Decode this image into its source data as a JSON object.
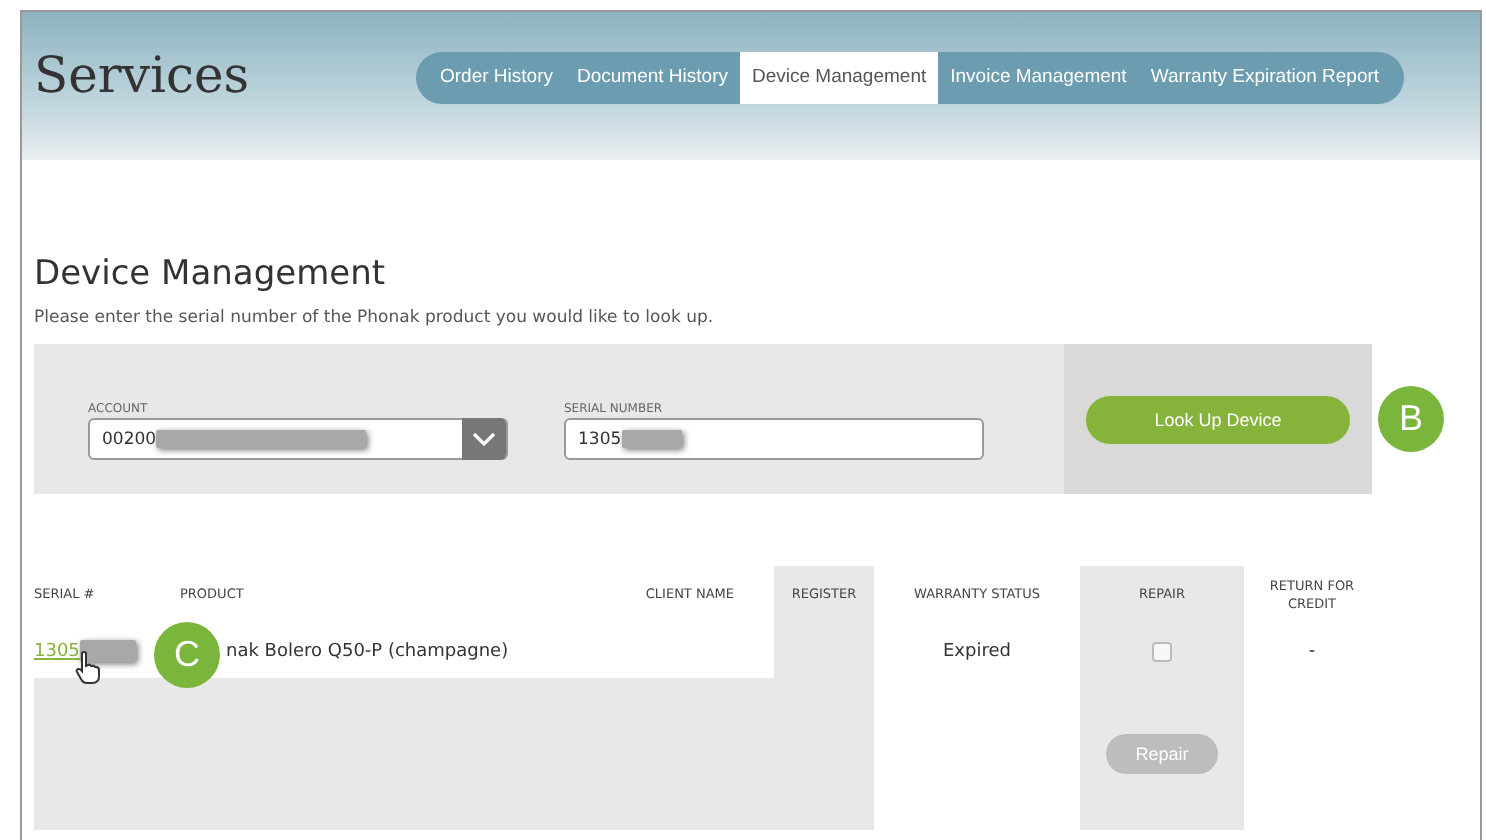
{
  "header": {
    "title": "Services"
  },
  "tabs": [
    {
      "label": "Order History",
      "selected": false
    },
    {
      "label": "Document History",
      "selected": false
    },
    {
      "label": "Device Management",
      "selected": true
    },
    {
      "label": "Invoice Management",
      "selected": false
    },
    {
      "label": "Warranty Expiration Report",
      "selected": false
    }
  ],
  "section": {
    "heading": "Device Management",
    "description": "Please enter the serial number of the Phonak product you would like to look up."
  },
  "form": {
    "account": {
      "label": "ACCOUNT",
      "value": "00200"
    },
    "serial": {
      "label": "SERIAL NUMBER",
      "value": "1305"
    },
    "button": "Look Up Device"
  },
  "callouts": [
    "B",
    "C"
  ],
  "table": {
    "columns": [
      {
        "label": "SERIAL #",
        "shaded": false
      },
      {
        "label": "PRODUCT",
        "shaded": false
      },
      {
        "label": "CLIENT NAME",
        "shaded": false
      },
      {
        "label": "REGISTER",
        "shaded": true
      },
      {
        "label": "WARRANTY STATUS",
        "shaded": false
      },
      {
        "label": "REPAIR",
        "shaded": true
      },
      {
        "label": "RETURN FOR CREDIT",
        "shaded": false
      }
    ],
    "rows": [
      {
        "serial": "1305",
        "product": "nak Bolero Q50-P (champagne)",
        "warranty_status": "Expired",
        "repair_checked": false,
        "return_for_credit": "-"
      }
    ],
    "repair_button": {
      "label": "Repair",
      "disabled": true
    }
  }
}
